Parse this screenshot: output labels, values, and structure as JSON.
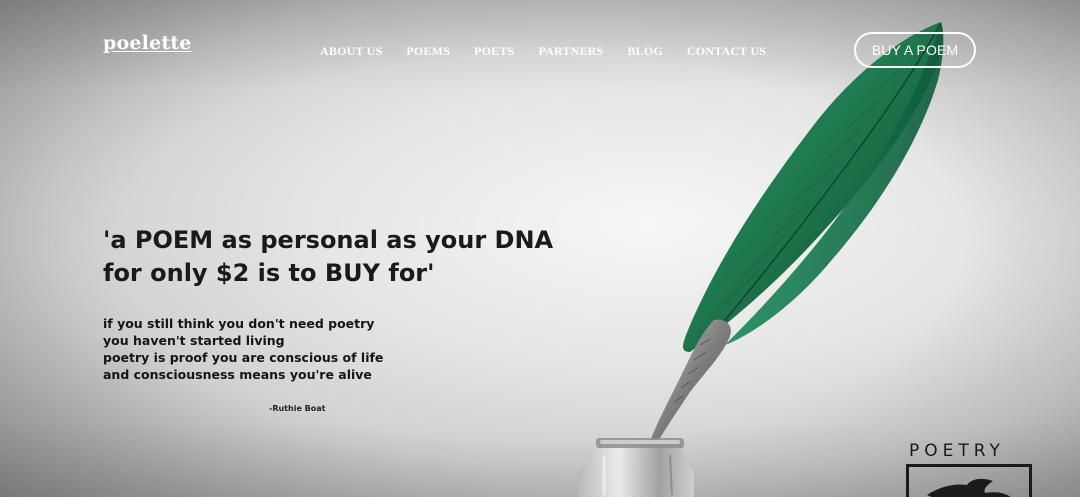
{
  "header": {
    "logo": "poelette",
    "nav": [
      {
        "label": "ABOUT US"
      },
      {
        "label": "POEMS"
      },
      {
        "label": "POETS"
      },
      {
        "label": "PARTNERS"
      },
      {
        "label": "BLOG"
      },
      {
        "label": "CONTACT US"
      }
    ],
    "cta_label": "BUY A POEM"
  },
  "hero": {
    "headline_lines": [
      "'a POEM as personal as your DNA",
      "for only $2 is to BUY for'"
    ],
    "poem_lines": [
      "if you still think you don't need poetry",
      "you haven't started living",
      "poetry is proof you are conscious of life",
      "and consciousness means you're alive"
    ],
    "author": "-Ruthie Boat"
  },
  "artwork": {
    "feather_color": "#1f7a4f",
    "feather_dark": "#0f4a30",
    "quill_tip_color": "#8d8d8d",
    "stamp_word": "POETRY"
  },
  "icons": {
    "feather": "quill-feather-icon",
    "inkwell": "inkwell-icon",
    "stamp_bird": "bird-icon"
  }
}
